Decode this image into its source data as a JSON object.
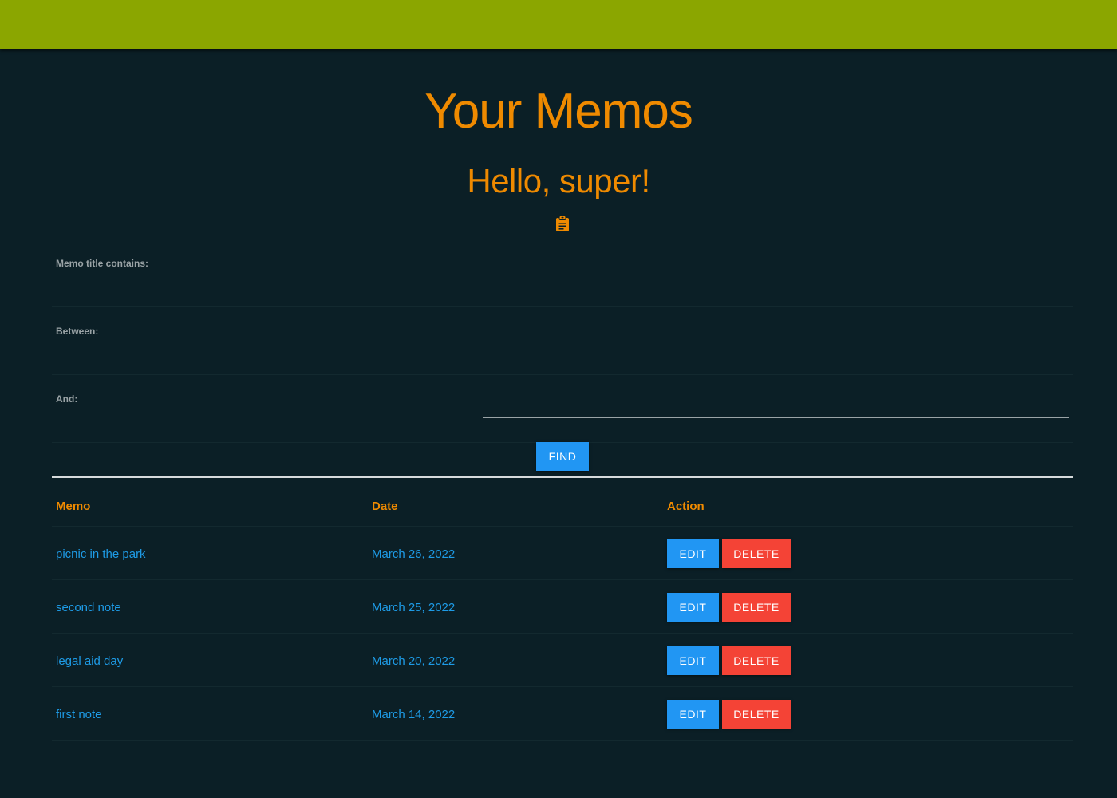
{
  "header": {
    "title": "Your Memos",
    "greeting": "Hello, super!",
    "icon": "clipboard-icon",
    "colors": {
      "topbar": "#8ba600",
      "background": "#0b1f26",
      "accent": "#ef8a00",
      "link": "#1e9be6",
      "primary_button": "#2196f3",
      "danger_button": "#f44336"
    }
  },
  "filters": {
    "title_label": "Memo title contains:",
    "title_value": "",
    "between_label": "Between:",
    "between_value": "",
    "and_label": "And:",
    "and_value": "",
    "find_label": "FIND"
  },
  "table": {
    "columns": [
      "Memo",
      "Date",
      "Action"
    ],
    "rows": [
      {
        "memo": "picnic in the park",
        "date": "March 26, 2022",
        "edit": "EDIT",
        "delete": "DELETE"
      },
      {
        "memo": "second note",
        "date": "March 25, 2022",
        "edit": "EDIT",
        "delete": "DELETE"
      },
      {
        "memo": "legal aid day",
        "date": "March 20, 2022",
        "edit": "EDIT",
        "delete": "DELETE"
      },
      {
        "memo": "first note",
        "date": "March 14, 2022",
        "edit": "EDIT",
        "delete": "DELETE"
      }
    ]
  }
}
